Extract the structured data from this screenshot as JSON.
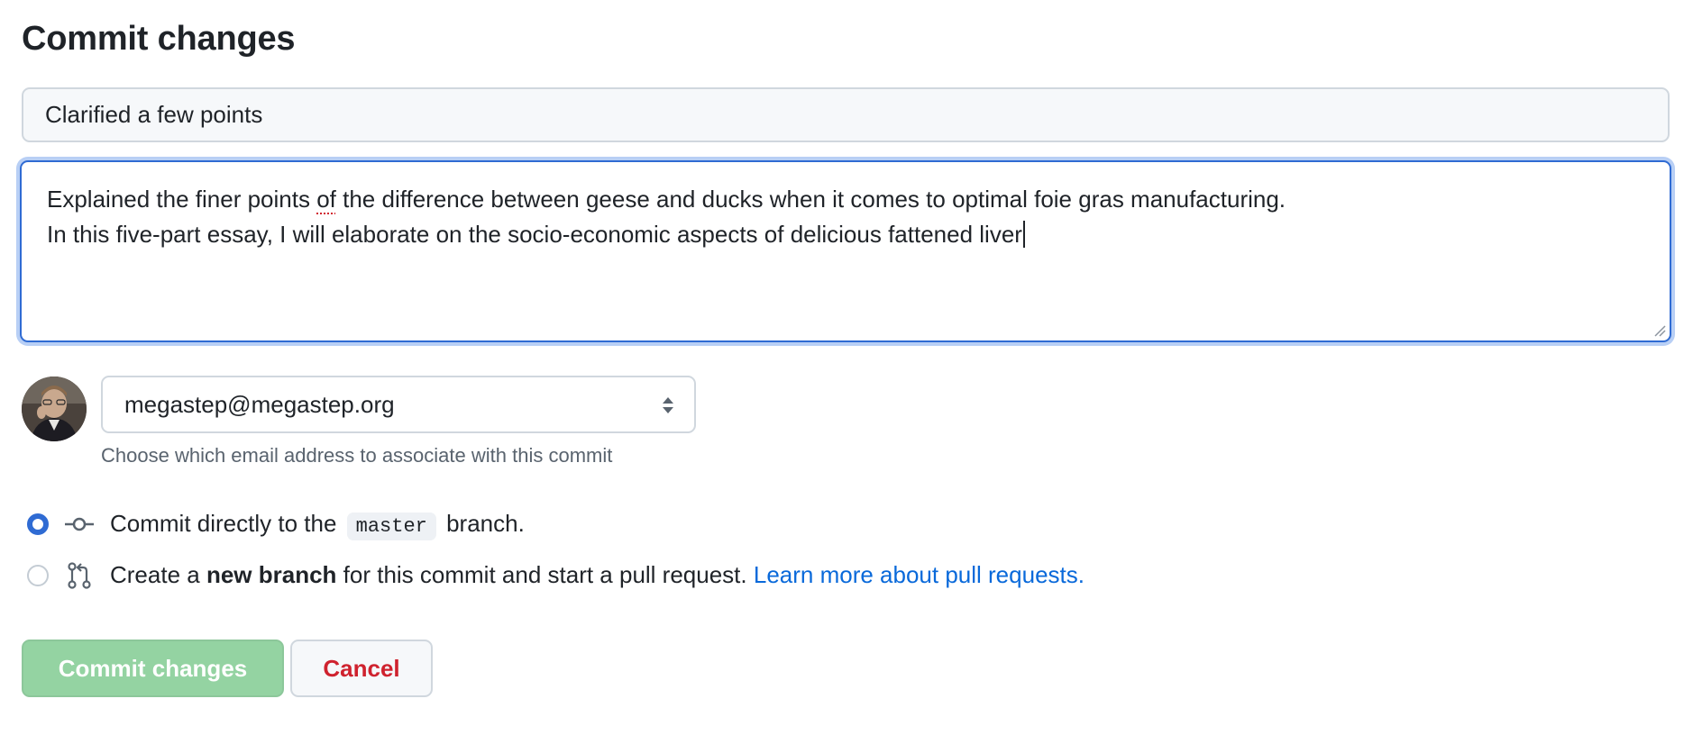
{
  "title": "Commit changes",
  "summary": {
    "value": "Clarified a few points"
  },
  "description": {
    "line1_before": "Explained the finer points ",
    "line1_misspelled": "of",
    "line1_after": " the difference between geese and ducks when it comes to optimal foie gras manufacturing.",
    "line2": "In this five-part essay, I will elaborate on the socio-economic aspects of delicious fattened liver"
  },
  "author": {
    "avatar_icon": "user-avatar",
    "email_selected": "megastep@megastep.org",
    "email_help": "Choose which email address to associate with this commit"
  },
  "options": {
    "direct": {
      "selected": true,
      "icon": "git-commit-icon",
      "text_before": "Commit directly to the",
      "branch": "master",
      "text_after": "branch."
    },
    "new_branch": {
      "selected": false,
      "icon": "git-pull-request-icon",
      "text_before": "Create a ",
      "bold": "new branch",
      "text_after": " for this commit and start a pull request. ",
      "link": "Learn more about pull requests."
    }
  },
  "buttons": {
    "commit": "Commit changes",
    "cancel": "Cancel"
  },
  "colors": {
    "accent": "#2f6bd3",
    "link": "#0969da",
    "commit_button_disabled": "#94d3a2",
    "cancel_text": "#cf222e"
  }
}
